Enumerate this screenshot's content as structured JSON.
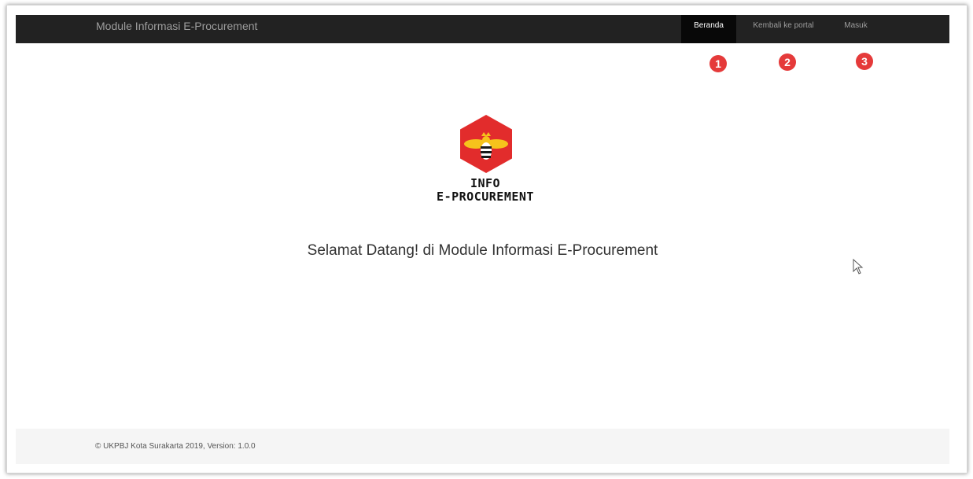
{
  "navbar": {
    "brand": "Module Informasi E-Procurement",
    "items": [
      {
        "label": "Beranda",
        "active": true
      },
      {
        "label": "Kembali ke portal",
        "active": false
      },
      {
        "label": "Masuk",
        "active": false
      }
    ]
  },
  "markers": [
    "1",
    "2",
    "3"
  ],
  "logo": {
    "line1": "INFO",
    "line2": "E-PROCUREMENT",
    "colors": {
      "hexagon": "#e22c2c",
      "wings": "#f6c31c",
      "body": "#1a1a1a"
    }
  },
  "main": {
    "welcome": "Selamat Datang! di Module Informasi E-Procurement"
  },
  "footer": {
    "text": "© UKPBJ Kota Surakarta 2019, Version: 1.0.0"
  },
  "colors": {
    "navbar_bg": "#222222",
    "nav_active_bg": "#080808",
    "nav_text": "#9d9d9d",
    "marker": "#e53a3a",
    "footer_bg": "#f5f5f5"
  }
}
